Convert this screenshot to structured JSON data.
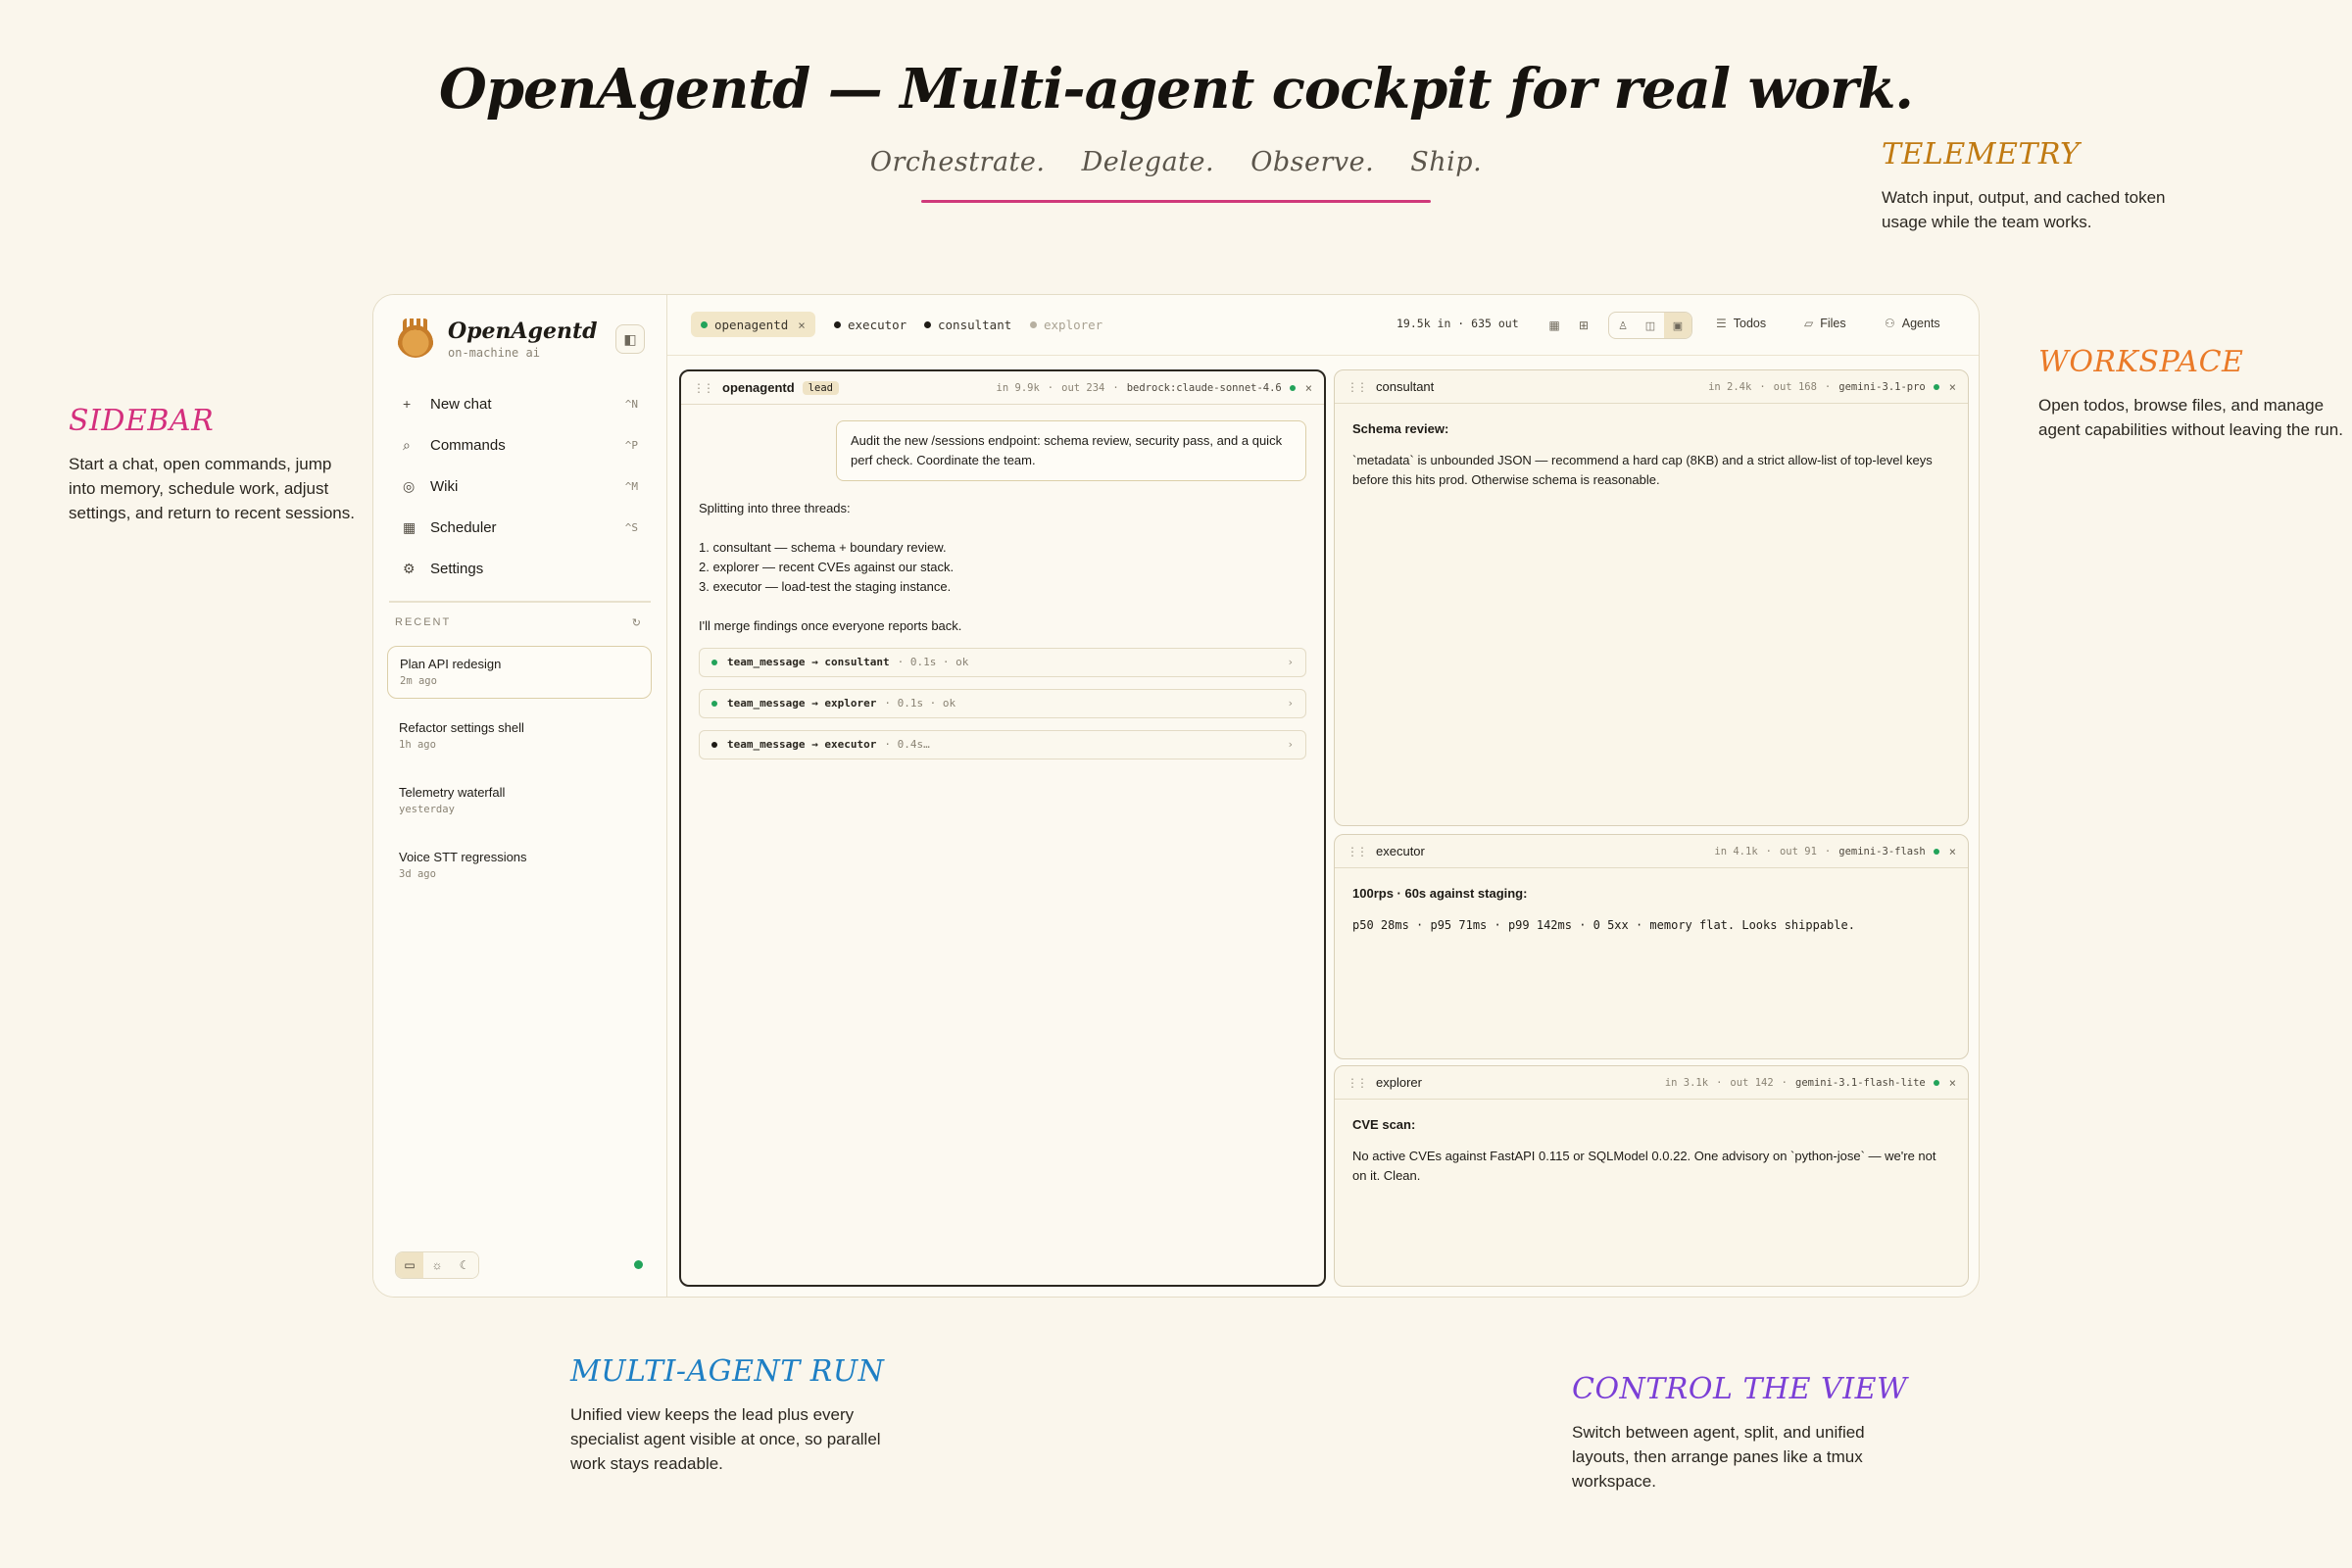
{
  "header": {
    "title": "OpenAgentd — Multi-agent cockpit for real work.",
    "tagline": [
      "Orchestrate.",
      "Delegate.",
      "Observe.",
      "Ship."
    ]
  },
  "callouts": {
    "sidebar": {
      "label": "SIDEBAR",
      "desc": "Start a chat, open commands, jump into memory, schedule work, adjust settings, and return to recent sessions.",
      "color": "#d42f7d"
    },
    "telemetry": {
      "label": "TELEMETRY",
      "desc": "Watch input, output, and cached token usage while the team works.",
      "color": "#c07a12"
    },
    "workspace": {
      "label": "WORKSPACE",
      "desc": "Open todos, browse files, and manage agent capabilities without leaving the run.",
      "color": "#ea7a28"
    },
    "multi_agent": {
      "label": "MULTI-AGENT RUN",
      "desc": "Unified view keeps the lead plus every specialist agent visible at once, so parallel work stays readable.",
      "color": "#1e7fc4"
    },
    "control": {
      "label": "CONTROL THE VIEW",
      "desc": "Switch between agent, split, and unified layouts, then arrange panes like a tmux workspace.",
      "color": "#7b3fd6"
    }
  },
  "sidebar": {
    "brand_name": "OpenAgentd",
    "brand_sub": "on-machine ai",
    "nav": [
      {
        "icon": "+",
        "label": "New chat",
        "kbd": "^N"
      },
      {
        "icon": "⌕",
        "label": "Commands",
        "kbd": "^P"
      },
      {
        "icon": "◎",
        "label": "Wiki",
        "kbd": "^M"
      },
      {
        "icon": "▦",
        "label": "Scheduler",
        "kbd": "^S"
      },
      {
        "icon": "⚙",
        "label": "Settings",
        "kbd": ""
      }
    ],
    "recent_label": "RECENT",
    "recents": [
      {
        "title": "Plan API redesign",
        "time": "2m ago"
      },
      {
        "title": "Refactor settings shell",
        "time": "1h ago"
      },
      {
        "title": "Telemetry waterfall",
        "time": "yesterday"
      },
      {
        "title": "Voice STT regressions",
        "time": "3d ago"
      }
    ]
  },
  "topbar": {
    "tabs": [
      "openagentd",
      "executor",
      "consultant",
      "explorer"
    ],
    "tokens": "19.5k in · 635 out",
    "todos": "Todos",
    "files": "Files",
    "agents": "Agents"
  },
  "panes": {
    "lead": {
      "name": "openagentd",
      "badge": "lead",
      "in": "in 9.9k",
      "out": "out 234",
      "model": "bedrock:claude-sonnet-4.6",
      "user_msg": "Audit the new /sessions endpoint: schema review, security pass, and a quick perf check. Coordinate the team.",
      "reply_intro": "Splitting into three threads:",
      "reply_items": [
        "1. consultant — schema + boundary review.",
        "2. explorer — recent CVEs against our stack.",
        "3. executor — load-test the staging instance."
      ],
      "reply_outro": "I'll merge findings once everyone reports back.",
      "tools": [
        {
          "name": "team_message → consultant",
          "status": "· 0.1s · ok"
        },
        {
          "name": "team_message → explorer",
          "status": "· 0.1s · ok"
        },
        {
          "name": "team_message → executor",
          "status": "· 0.4s…"
        }
      ]
    },
    "consultant": {
      "name": "consultant",
      "in": "in 2.4k",
      "out": "out 168",
      "model": "gemini-3.1-pro",
      "heading": "Schema review:",
      "body": "`metadata` is unbounded JSON — recommend a hard cap (8KB) and a strict allow-list of top-level keys before this hits prod. Otherwise schema is reasonable."
    },
    "executor": {
      "name": "executor",
      "in": "in 4.1k",
      "out": "out 91",
      "model": "gemini-3-flash",
      "heading": "100rps · 60s against staging:",
      "body": "p50 28ms · p95 71ms · p99 142ms · 0 5xx · memory flat. Looks shippable."
    },
    "explorer": {
      "name": "explorer",
      "in": "in 3.1k",
      "out": "out 142",
      "model": "gemini-3.1-flash-lite",
      "heading": "CVE scan:",
      "body": "No active CVEs against FastAPI 0.115 or SQLModel 0.0.22. One advisory on `python-jose` — we're not on it. Clean."
    }
  }
}
